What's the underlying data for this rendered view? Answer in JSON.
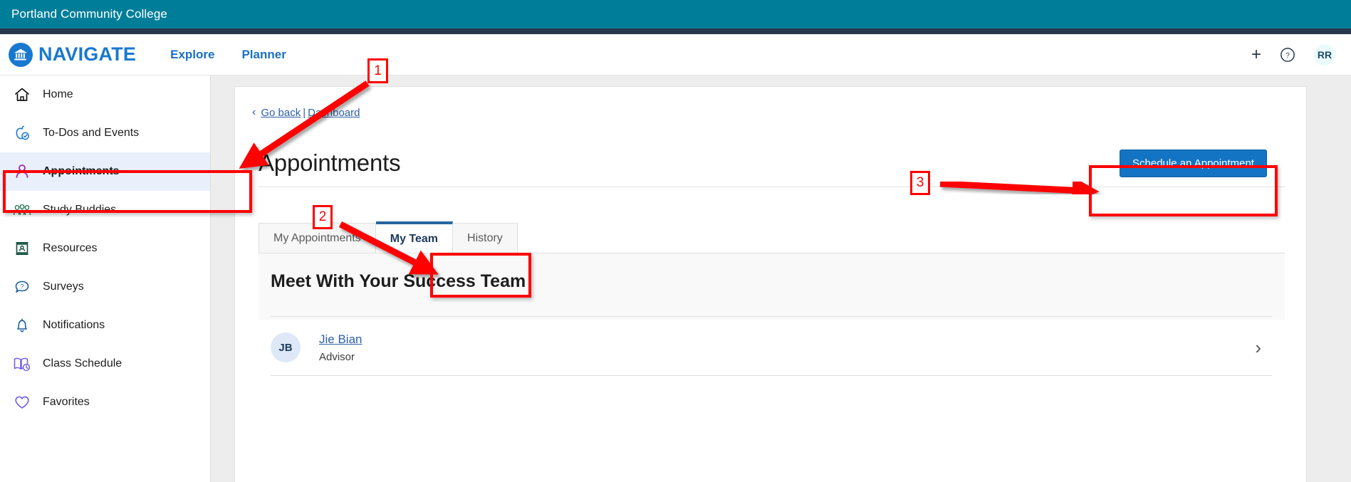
{
  "college_bar": {
    "name": "Portland Community College"
  },
  "appnav": {
    "brand": "NAVIGATE",
    "links": [
      {
        "label": "Explore"
      },
      {
        "label": "Planner"
      }
    ],
    "plus_label": "+",
    "help_label": "?",
    "user_initials": "RR"
  },
  "sidebar": {
    "items": [
      {
        "label": "Home",
        "icon": "home-icon",
        "active": false
      },
      {
        "label": "To-Dos and Events",
        "icon": "apple-check-icon",
        "active": false
      },
      {
        "label": "Appointments",
        "icon": "person-icon",
        "active": true
      },
      {
        "label": "Study Buddies",
        "icon": "people-icon",
        "active": false
      },
      {
        "label": "Resources",
        "icon": "id-card-icon",
        "active": false
      },
      {
        "label": "Surveys",
        "icon": "speech-question-icon",
        "active": false
      },
      {
        "label": "Notifications",
        "icon": "bell-icon",
        "active": false
      },
      {
        "label": "Class Schedule",
        "icon": "book-clock-icon",
        "active": false
      },
      {
        "label": "Favorites",
        "icon": "heart-icon",
        "active": false
      }
    ]
  },
  "main": {
    "breadcrumb": {
      "back_label": "Go back",
      "separator": "|",
      "dashboard_label": "Dashboard"
    },
    "page_title": "Appointments",
    "schedule_button": "Schedule an Appointment",
    "tabs": [
      {
        "label": "My Appointments",
        "selected": false
      },
      {
        "label": "My Team",
        "selected": true
      },
      {
        "label": "History",
        "selected": false
      }
    ],
    "team": {
      "title": "Meet With Your Success Team",
      "members": [
        {
          "initials": "JB",
          "name": "Jie Bian",
          "role": "Advisor"
        }
      ]
    }
  },
  "annotations": {
    "markers": [
      {
        "number": "1"
      },
      {
        "number": "2"
      },
      {
        "number": "3"
      }
    ]
  },
  "colors": {
    "college_teal": "#007e99",
    "navy_strip": "#27384f",
    "brand_blue": "#1878d0",
    "link_blue": "#2b5fa8",
    "button_blue": "#1474c4",
    "tab_accent": "#26659e",
    "annotation_red": "#ff0000",
    "active_item_bg": "#eaf0fb"
  }
}
